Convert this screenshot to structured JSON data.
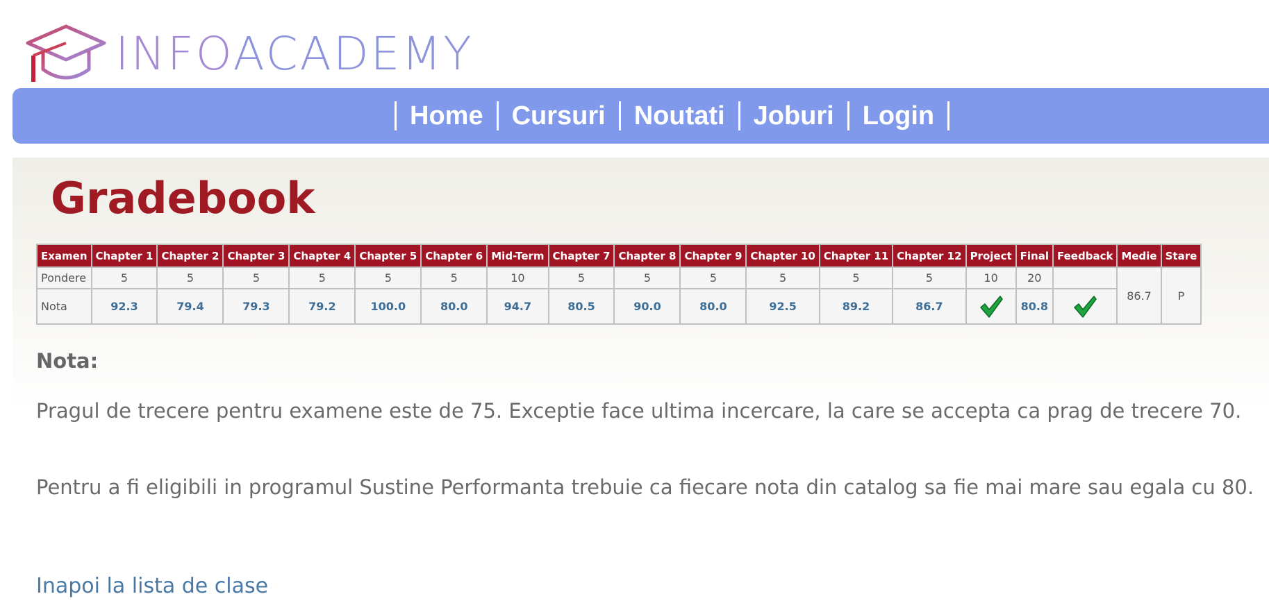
{
  "brand": {
    "logo_part1": "INFO",
    "logo_part2": "ACADEMY"
  },
  "nav": {
    "items": [
      "Home",
      "Cursuri",
      "Noutati",
      "Joburi",
      "Login"
    ]
  },
  "page": {
    "title": "Gradebook"
  },
  "gradebook": {
    "headers": [
      "Examen",
      "Chapter 1",
      "Chapter 2",
      "Chapter 3",
      "Chapter 4",
      "Chapter 5",
      "Chapter 6",
      "Mid-Term",
      "Chapter 7",
      "Chapter 8",
      "Chapter 9",
      "Chapter 10",
      "Chapter 11",
      "Chapter 12",
      "Project",
      "Final",
      "Feedback",
      "Medie",
      "Stare"
    ],
    "pondere_label": "Pondere",
    "pondere": [
      "5",
      "5",
      "5",
      "5",
      "5",
      "5",
      "10",
      "5",
      "5",
      "5",
      "5",
      "5",
      "5",
      "10",
      "20",
      ""
    ],
    "nota_label": "Nota",
    "nota": [
      "92.3",
      "79.4",
      "79.3",
      "79.2",
      "100.0",
      "80.0",
      "94.7",
      "80.5",
      "90.0",
      "80.0",
      "92.5",
      "89.2",
      "86.7",
      "check",
      "80.8",
      "check"
    ],
    "medie": "86.7",
    "stare": "P"
  },
  "notes": {
    "heading": "Nota:",
    "paragraph1": "Pragul de trecere pentru examene este de 75. Exceptie face ultima incercare, la care se accepta ca prag de trecere 70.",
    "paragraph2": "Pentru a fi eligibili in programul Sustine Performanta trebuie ca fiecare nota din catalog sa fie mai mare sau egala cu 80."
  },
  "back_link": "Inapoi la lista de clase",
  "colors": {
    "nav_bg": "#8199ea",
    "title": "#9f1a22",
    "table_header": "#a01424",
    "grade_text": "#3f6e96",
    "link": "#4a79a6"
  }
}
